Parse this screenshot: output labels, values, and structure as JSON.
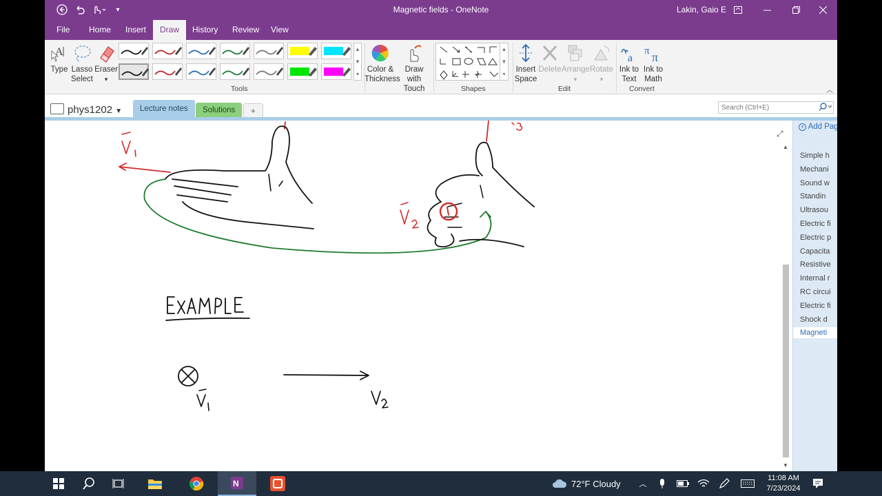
{
  "window": {
    "title": "Magnetic fields  -  OneNote",
    "user": "Lakin, Gaio E"
  },
  "menu_tabs": [
    "File",
    "Home",
    "Insert",
    "Draw",
    "History",
    "Review",
    "View"
  ],
  "active_tab": "Draw",
  "ribbon": {
    "tools": {
      "type": "Type",
      "lasso_line1": "Lasso",
      "lasso_line2": "Select",
      "eraser": "Eraser",
      "label": "Tools"
    },
    "color_thickness": {
      "line1": "Color &",
      "line2": "Thickness"
    },
    "draw_touch": {
      "line1": "Draw with",
      "line2": "Touch"
    },
    "shapes_label": "Shapes",
    "edit": {
      "insert_line1": "Insert",
      "insert_line2": "Space",
      "delete": "Delete",
      "arrange": "Arrange",
      "rotate": "Rotate",
      "label": "Edit"
    },
    "convert": {
      "ink_text_line1": "Ink to",
      "ink_text_line2": "Text",
      "ink_math_line1": "Ink to",
      "ink_math_line2": "Math",
      "label": "Convert"
    },
    "pen_colors_row1": [
      "#1a1a1a",
      "#c0282d",
      "#2d6db5",
      "#1e7b3a",
      "#7a7a7a",
      "#ffff00",
      "#00e5ff"
    ],
    "pen_colors_row2": [
      "#1a1a1a",
      "#c0282d",
      "#2d6db5",
      "#1e7b3a",
      "#7a7a7a",
      "#00e600",
      "#ff00ff"
    ]
  },
  "notebook": {
    "name": "phys1202"
  },
  "section_tabs": {
    "lecture": "Lecture notes",
    "solutions": "Solutions",
    "add": "+"
  },
  "search": {
    "placeholder": "Search (Ctrl+E)"
  },
  "page_panel": {
    "add_page": "Add Page",
    "pages": [
      "Simple h",
      "Mechani",
      "Sound w",
      "Standin",
      "Ultrasou",
      "Electric fi",
      "Electric p",
      "Capacita",
      "Resistive",
      "Internal r",
      "RC circui",
      "Electric fi",
      "Shock d",
      "Magneti"
    ],
    "active_index": 13
  },
  "ink": {
    "heading": "EXAMPLE",
    "v1": "V",
    "v2": "V",
    "v1_sub": "1",
    "v2_sub": "2",
    "v3_sub": "3"
  },
  "taskbar": {
    "weather": "72°F  Cloudy",
    "time": "11:08 AM",
    "date": "7/23/2024"
  },
  "colors": {
    "onenote_purple": "#7b3c8e",
    "ink_red": "#d32b2b",
    "ink_green": "#1e7b2f",
    "section_blue": "#a8cde8",
    "section_green": "#8ccf7e"
  }
}
